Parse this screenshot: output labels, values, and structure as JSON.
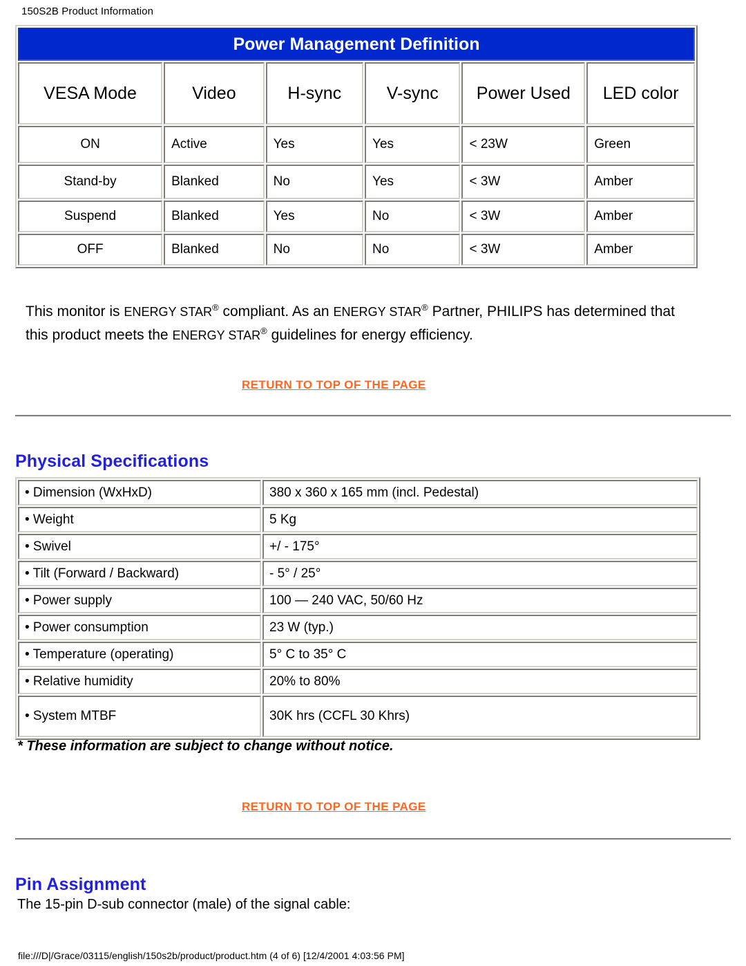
{
  "document": {
    "header_title": "150S2B Product Information",
    "footer": "file:///D|/Grace/03115/english/150s2b/product/product.htm (4 of 6) [12/4/2001 4:03:56 PM]",
    "accent_blue": "#2222dd",
    "title_bar_blue": "#0028cc",
    "link_orange": "#ff6721"
  },
  "power_management": {
    "title": "Power Management Definition",
    "columns": [
      "VESA Mode",
      "Video",
      "H-sync",
      "V-sync",
      "Power Used",
      "LED color"
    ],
    "rows": [
      {
        "mode": "ON",
        "video": "Active",
        "hsync": "Yes",
        "vsync": "Yes",
        "power": "< 23W",
        "led": "Green"
      },
      {
        "mode": "Stand-by",
        "video": "Blanked",
        "hsync": "No",
        "vsync": "Yes",
        "power": "< 3W",
        "led": "Amber"
      },
      {
        "mode": "Suspend",
        "video": "Blanked",
        "hsync": "Yes",
        "vsync": "No",
        "power": "< 3W",
        "led": "Amber"
      },
      {
        "mode": "OFF",
        "video": "Blanked",
        "hsync": "No",
        "vsync": "No",
        "power": "< 3W",
        "led": "Amber"
      }
    ]
  },
  "energy_star": {
    "part1": "This monitor is ",
    "brand1": "ENERGY STAR",
    "part2": " compliant. As an ",
    "brand2": "ENERGY STAR",
    "part3": " Partner, PHILIPS has determined that this product meets the ",
    "brand3": "ENERGY STAR",
    "part4": " guidelines for energy efficiency."
  },
  "links": {
    "return_to_top": "RETURN TO TOP OF THE PAGE"
  },
  "physical_specifications": {
    "heading": "Physical Specifications",
    "rows": [
      {
        "label": "• Dimension (WxHxD)",
        "value": "380 x 360 x 165 mm (incl. Pedestal)"
      },
      {
        "label": "• Weight",
        "value": "5 Kg"
      },
      {
        "label": "• Swivel",
        "value": "+/ - 175°"
      },
      {
        "label": "• Tilt (Forward / Backward)",
        "value": "- 5° / 25°"
      },
      {
        "label": "• Power supply",
        "value": "100 — 240 VAC, 50/60 Hz"
      },
      {
        "label": "• Power consumption",
        "value": "23 W (typ.)"
      },
      {
        "label": "• Temperature (operating)",
        "value": "5° C to 35° C"
      },
      {
        "label": "• Relative humidity",
        "value": "20% to 80%"
      },
      {
        "label": "• System MTBF",
        "value": "30K hrs (CCFL 30 Khrs)"
      }
    ],
    "notice": "* These information are subject to change without notice."
  },
  "pin_assignment": {
    "heading": "Pin Assignment",
    "intro": "The 15-pin D-sub connector (male) of the signal cable:"
  }
}
